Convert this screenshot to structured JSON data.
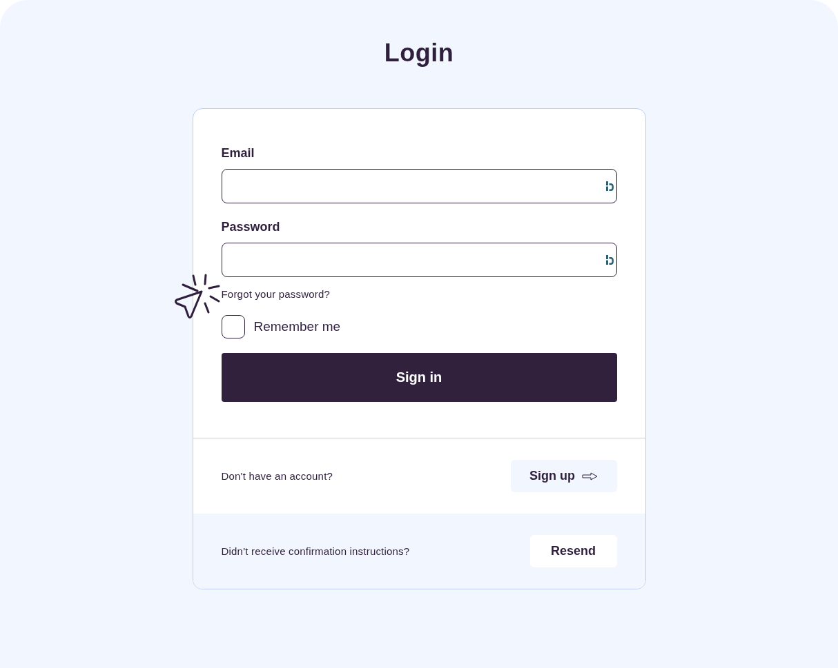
{
  "title": "Login",
  "form": {
    "fields": [
      {
        "label": "Email"
      },
      {
        "label": "Password"
      }
    ],
    "forgot_link": "Forgot your password?",
    "remember": {
      "label": "Remember me",
      "checked": false
    },
    "submit": "Sign in"
  },
  "signup": {
    "text": "Don't have an account?",
    "button": "Sign up"
  },
  "resend": {
    "text": "Didn't receive confirmation instructions?",
    "button": "Resend"
  }
}
